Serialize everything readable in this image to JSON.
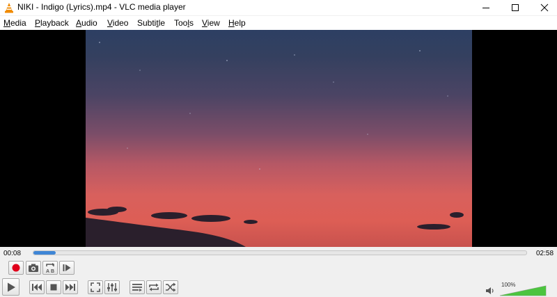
{
  "window": {
    "title": "NIKI - Indigo (Lyrics).mp4 - VLC media player"
  },
  "menu": [
    {
      "label_ul": "M",
      "label_rest": "edia"
    },
    {
      "label_ul": "P",
      "label_rest": "layback"
    },
    {
      "label_ul": "A",
      "label_rest": "udio"
    },
    {
      "label_ul": "V",
      "label_rest": "ideo"
    },
    {
      "label_pre": "Subti",
      "label_ul": "t",
      "label_rest": "le"
    },
    {
      "label_pre": "Too",
      "label_ul": "l",
      "label_rest": "s"
    },
    {
      "label_ul": "V",
      "label_rest": "iew"
    },
    {
      "label_ul": "H",
      "label_rest": "elp"
    }
  ],
  "playback": {
    "elapsed": "00:08",
    "total": "02:58",
    "progress": 0.045
  },
  "volume": {
    "label": "100%",
    "level": 1.0
  },
  "icons": {
    "record": "record-icon",
    "snapshot": "camera-icon",
    "loop_ab": "loop-ab-icon",
    "frame_step": "frame-step-icon",
    "play": "play-icon",
    "previous": "previous-icon",
    "stop": "stop-icon",
    "next": "next-icon",
    "fullscreen": "fullscreen-icon",
    "extended": "extended-settings-icon",
    "playlist": "playlist-icon",
    "loop": "loop-icon",
    "shuffle": "shuffle-icon",
    "speaker": "speaker-icon"
  },
  "colors": {
    "accent": "#3f86d6",
    "record": "#e0001b",
    "volume": "#4cc43f"
  }
}
